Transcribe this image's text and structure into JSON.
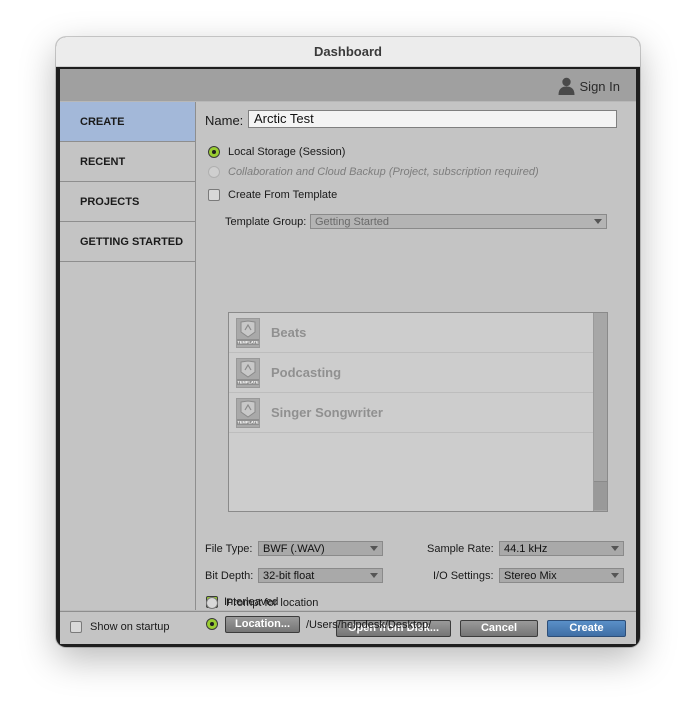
{
  "window": {
    "title": "Dashboard"
  },
  "header": {
    "sign_in_label": "Sign In",
    "user_icon": "user-icon"
  },
  "sidebar": {
    "items": [
      {
        "label": "CREATE",
        "active": true
      },
      {
        "label": "RECENT",
        "active": false
      },
      {
        "label": "PROJECTS",
        "active": false
      },
      {
        "label": "GETTING STARTED",
        "active": false
      }
    ]
  },
  "create": {
    "name_label": "Name:",
    "name_value": "Arctic Test",
    "storage_local": "Local Storage (Session)",
    "storage_cloud": "Collaboration and Cloud Backup (Project, subscription required)",
    "from_template_label": "Create From Template",
    "template_group_label": "Template Group:",
    "template_group_value": "Getting Started",
    "template_icon_text": "TEMPLATE",
    "templates": [
      {
        "name": "Beats"
      },
      {
        "name": "Podcasting"
      },
      {
        "name": "Singer Songwriter"
      }
    ],
    "file_type_label": "File Type:",
    "file_type_value": "BWF (.WAV)",
    "sample_rate_label": "Sample Rate:",
    "sample_rate_value": "44.1 kHz",
    "bit_depth_label": "Bit Depth:",
    "bit_depth_value": "32-bit float",
    "io_settings_label": "I/O Settings:",
    "io_settings_value": "Stereo Mix",
    "interleaved_label": "Interleaved",
    "prompt_location_label": "Prompt for location",
    "location_button": "Location...",
    "location_path": "/Users/helpdesk/Desktop/"
  },
  "footer": {
    "show_on_startup": "Show on startup",
    "open_from_disk": "Open from Disk...",
    "cancel": "Cancel",
    "create": "Create"
  },
  "colors": {
    "active_tab": "#a3b8d9",
    "accent_green": "#9acd32",
    "primary_button": "#4a7fb8"
  }
}
